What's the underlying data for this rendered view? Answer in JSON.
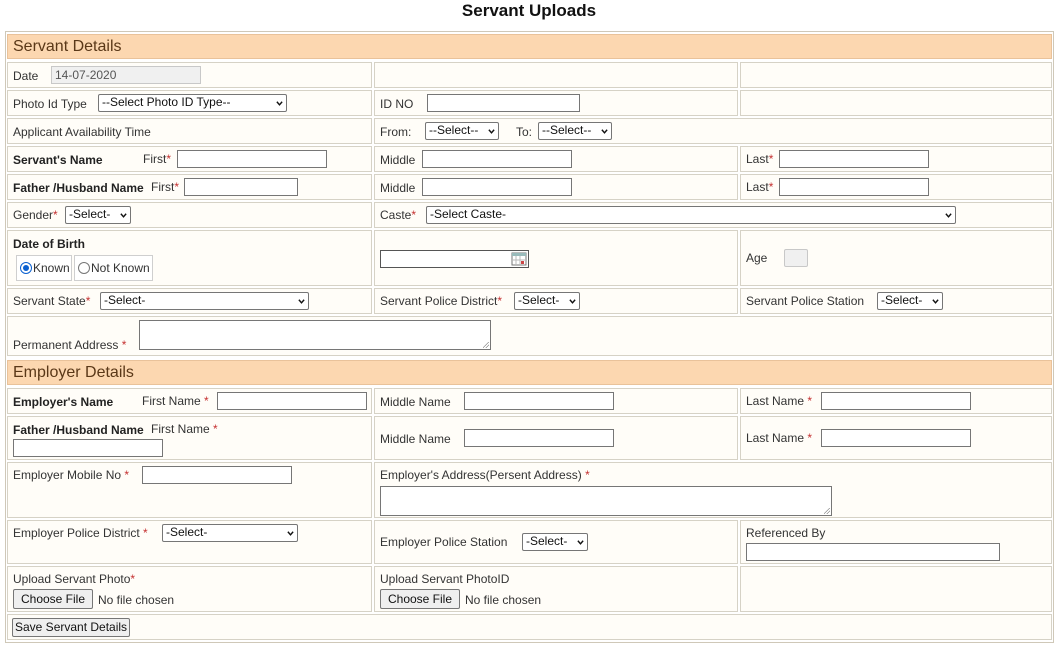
{
  "page_title": "Servant Uploads",
  "sections": {
    "servant": "Servant Details",
    "employer": "Employer Details"
  },
  "date": {
    "label": "Date",
    "value": "14-07-2020"
  },
  "photo_id": {
    "label": "Photo Id Type",
    "selected": "--Select Photo ID Type--"
  },
  "id_no": {
    "label": "ID NO",
    "value": ""
  },
  "availability": {
    "label": "Applicant Availability Time",
    "from_label": "From:",
    "from_selected": "--Select--",
    "to_label": "To:",
    "to_selected": "--Select--"
  },
  "servant_name": {
    "label": "Servant's Name",
    "first_label": "First",
    "middle_label": "Middle",
    "last_label": "Last",
    "first": "",
    "middle": "",
    "last": ""
  },
  "father_name": {
    "label": "Father /Husband Name",
    "first_label": "First",
    "middle_label": "Middle",
    "last_label": "Last",
    "first": "",
    "middle": "",
    "last": ""
  },
  "gender": {
    "label": "Gender",
    "selected": "-Select-"
  },
  "caste": {
    "label": "Caste",
    "selected": "-Select Caste-"
  },
  "dob": {
    "label": "Date of Birth",
    "known": "Known",
    "not_known": "Not Known",
    "selected": "Known",
    "value": ""
  },
  "age": {
    "label": "Age",
    "value": ""
  },
  "servant_state": {
    "label": "Servant State",
    "selected": "-Select-"
  },
  "servant_police_district": {
    "label": "Servant Police District",
    "selected": "-Select-"
  },
  "servant_police_station": {
    "label": "Servant Police Station",
    "selected": "-Select-"
  },
  "permanent_address": {
    "label": "Permanent Address",
    "value": ""
  },
  "employer_name": {
    "label": "Employer's Name",
    "first_label": "First Name",
    "middle_label": "Middle Name",
    "last_label": "Last Name",
    "first": "",
    "middle": "",
    "last": ""
  },
  "employer_father": {
    "label": "Father /Husband Name",
    "first_label": "First Name",
    "middle_label": "Middle Name",
    "last_label": "Last Name",
    "first": "",
    "middle": "",
    "last": ""
  },
  "employer_mobile": {
    "label": "Employer Mobile No",
    "value": ""
  },
  "employer_address": {
    "label": "Employer's Address(Persent Address)",
    "value": ""
  },
  "employer_police_district": {
    "label": "Employer Police District",
    "selected": "-Select-"
  },
  "employer_police_station": {
    "label": "Employer Police Station",
    "selected": "-Select-"
  },
  "referenced_by": {
    "label": "Referenced By",
    "value": ""
  },
  "upload_photo": {
    "label": "Upload Servant Photo",
    "button": "Choose File",
    "status": "No file chosen"
  },
  "upload_photoid": {
    "label": "Upload Servant PhotoID",
    "button": "Choose File",
    "status": "No file chosen"
  },
  "save_button": "Save Servant Details",
  "required_mark": "*",
  "colors": {
    "section_bg": "#fcd7b0",
    "section_text": "#5a3818",
    "required": "#c53030",
    "radio_accent": "#0a60d0"
  }
}
